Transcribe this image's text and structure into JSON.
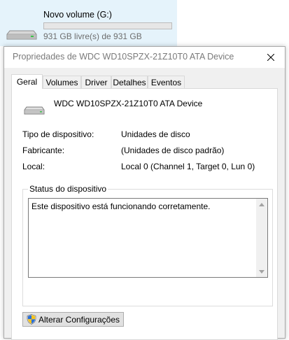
{
  "drive": {
    "name": "Novo volume (G:)",
    "free_text": "931 GB livre(s) de 931 GB",
    "used_fraction": 0.0,
    "icon": "drive-icon"
  },
  "dialog": {
    "title": "Propriedades de WDC WD10SPZX-21Z10T0 ATA Device",
    "close_icon": "close-icon",
    "tabs": [
      {
        "label": "Geral",
        "active": true
      },
      {
        "label": "Volumes",
        "active": false
      },
      {
        "label": "Driver",
        "active": false
      },
      {
        "label": "Detalhes",
        "active": false
      },
      {
        "label": "Eventos",
        "active": false
      }
    ],
    "device_name": "WDC WD10SPZX-21Z10T0 ATA Device",
    "properties": [
      {
        "label": "Tipo de dispositivo:",
        "value": "Unidades de disco"
      },
      {
        "label": "Fabricante:",
        "value": "(Unidades de disco padrão)"
      },
      {
        "label": "Local:",
        "value": "Local 0 (Channel 1, Target 0, Lun 0)"
      }
    ],
    "status_group_title": "Status do dispositivo",
    "status_text": "Este dispositivo está funcionando corretamente.",
    "change_settings_label": "Alterar Configurações"
  },
  "colors": {
    "accent": "#26a0da",
    "tile_highlight": "#e5f3fb",
    "dialog_bg": "#f0f0f0"
  }
}
